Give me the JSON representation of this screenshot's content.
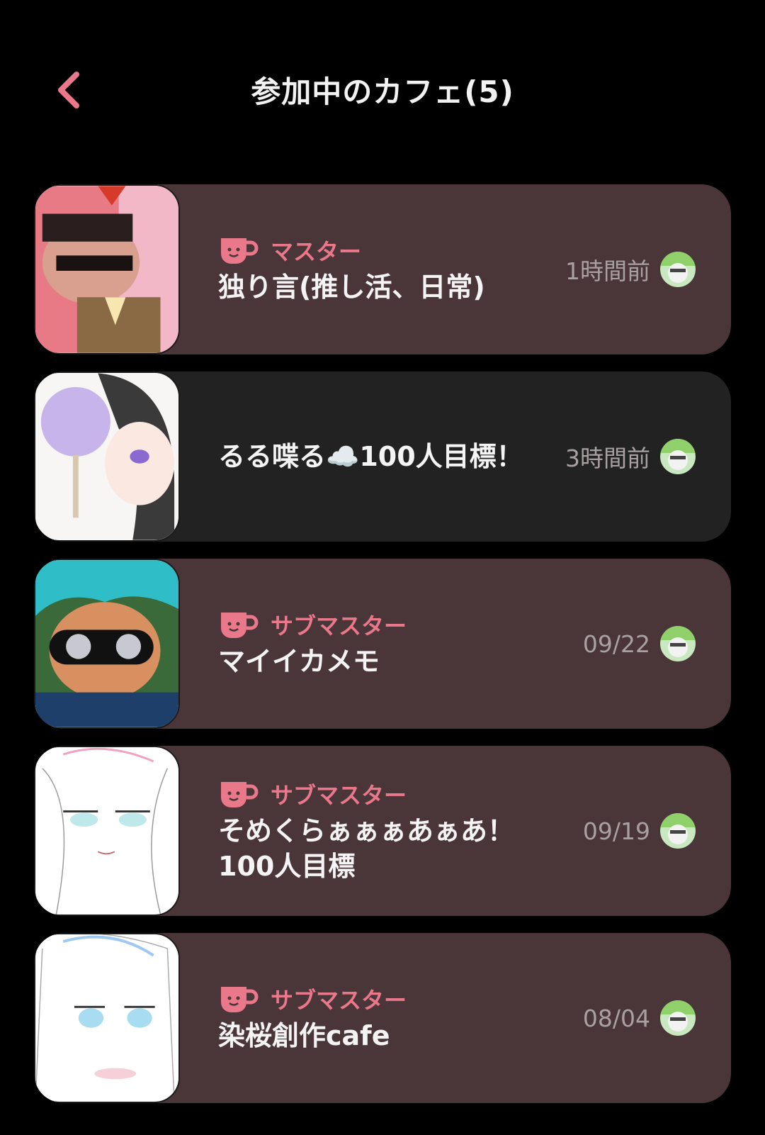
{
  "header": {
    "title": "参加中のカフェ(5)"
  },
  "colors": {
    "accent": "#e8788a",
    "card_owned": "#4a3538",
    "card_plain": "#222222"
  },
  "cafes": [
    {
      "role": "マスター",
      "name": "独り言(推し活、日常)",
      "time": "1時間前"
    },
    {
      "role": "",
      "name": "るる喋る☁️100人目標！",
      "time": "3時間前"
    },
    {
      "role": "サブマスター",
      "name": "マイイカメモ",
      "time": "09/22"
    },
    {
      "role": "サブマスター",
      "name": "そめくらぁぁぁあぁあ！100人目標",
      "time": "09/19"
    },
    {
      "role": "サブマスター",
      "name": "染桜創作cafe",
      "time": "08/04"
    }
  ]
}
